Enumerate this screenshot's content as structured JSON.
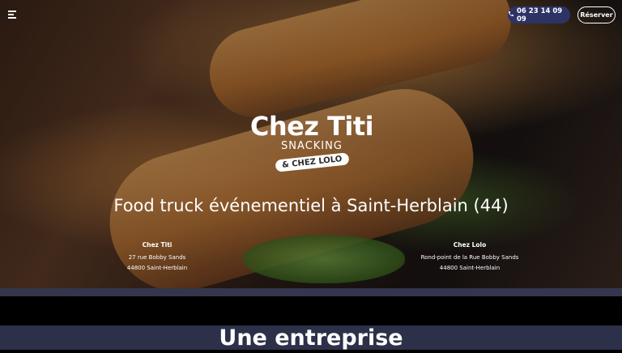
{
  "header": {
    "phone_label": "06 23 14 09 09",
    "reserve_label": "Réserver"
  },
  "logo": {
    "title": "Chez Titi",
    "subtitle": "SNACKING",
    "badge": "& CHEZ LOLO"
  },
  "hero": {
    "headline": "Food truck événementiel à Saint-Herblain (44)"
  },
  "locations": [
    {
      "name": "Chez Titi",
      "line1": "27 rue Bobby Sands",
      "line2": "44800 Saint-Herblain"
    },
    {
      "name": "Chez Lolo",
      "line1": "Rond-point de la Rue Bobby Sands",
      "line2": "44800 Saint-Herblain"
    }
  ],
  "section": {
    "title": "Une entreprise"
  },
  "colors": {
    "phone_button": "#2e3366",
    "band": "#2c3048"
  }
}
